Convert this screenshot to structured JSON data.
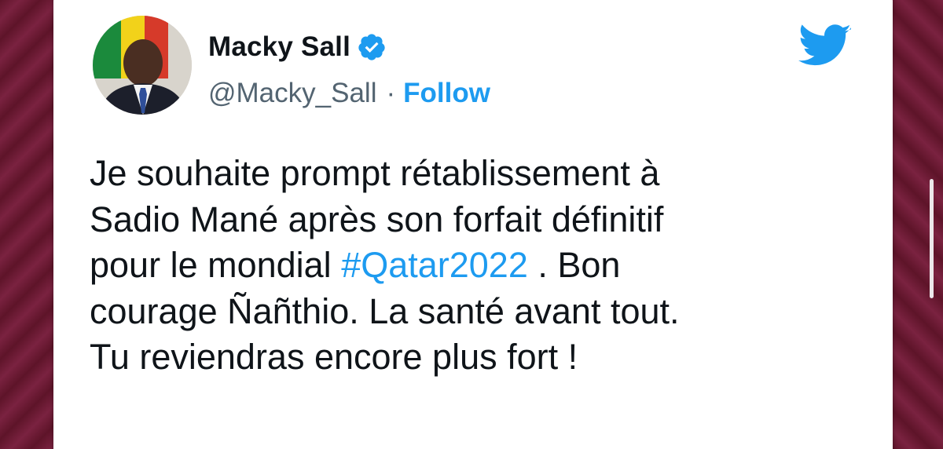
{
  "author": {
    "name": "Macky Sall",
    "handle": "@Macky_Sall",
    "separator": "·",
    "follow_label": "Follow",
    "verified": true
  },
  "tweet": {
    "lines": [
      {
        "text": "Je souhaite prompt rétablissement à"
      },
      {
        "text": "Sadio Mané après son forfait définitif"
      },
      {
        "before": "pour le mondial ",
        "hashtag": "#Qatar2022",
        "after": " . Bon"
      },
      {
        "text": "courage Ñañthio. La santé avant tout."
      },
      {
        "text": "Tu reviendras encore plus fort !"
      }
    ]
  },
  "icons": {
    "avatar": "profile-photo",
    "verified": "verified-badge-icon",
    "brand": "twitter-bird-icon"
  },
  "colors": {
    "accent": "#1d9bf0",
    "text": "#0f1419",
    "secondary_text": "#536471",
    "background": "#6b1b33"
  }
}
